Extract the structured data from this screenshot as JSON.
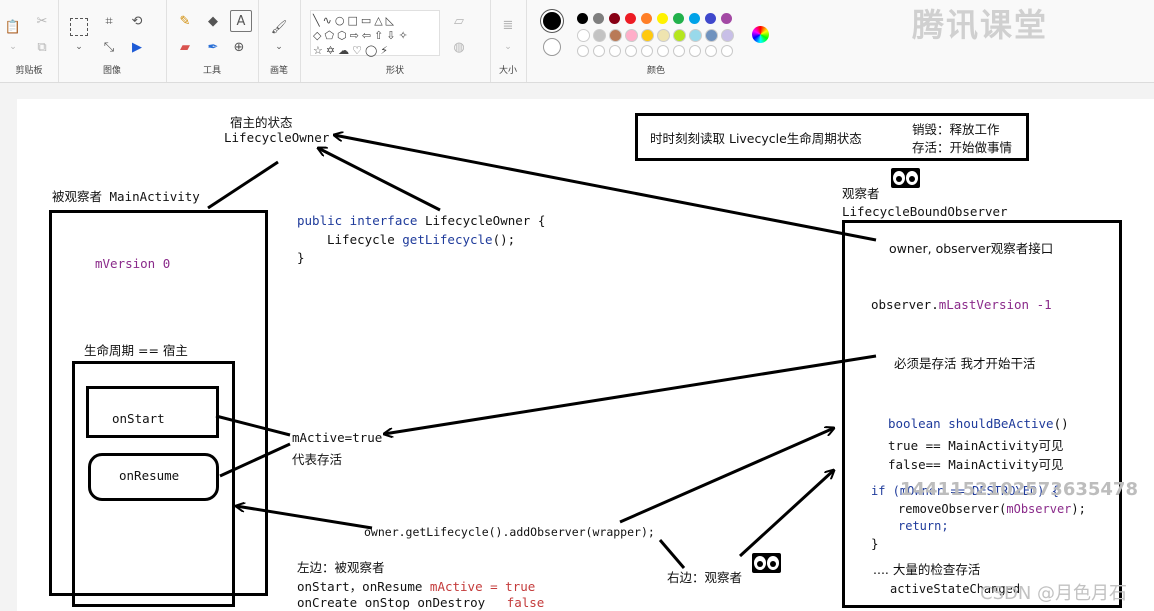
{
  "ribbon": {
    "groups": {
      "clipboard": "剪贴板",
      "image": "图像",
      "tools": "工具",
      "brushes": "画笔",
      "shapes": "形状",
      "size": "大小",
      "colors": "颜色"
    },
    "tools_text_glyph": "A",
    "palette_row1": [
      "#000000",
      "#7f7f7f",
      "#880015",
      "#ed1c24",
      "#ff7f27",
      "#fff200",
      "#22b14c",
      "#00a2e8",
      "#3f48cc",
      "#a349a4"
    ],
    "palette_row2": [
      "#ffffff",
      "#c3c3c3",
      "#b97a57",
      "#ffaec9",
      "#ffc90e",
      "#efe4b0",
      "#b5e61d",
      "#99d9ea",
      "#7092be",
      "#c8bfe7"
    ],
    "watermark": "腾讯课堂"
  },
  "canvas": {
    "host_state_title": "宿主的状态",
    "host_state_owner": "LifecycleOwner",
    "observed_label": "被观察者 MainActivity",
    "mversion": "mVersion 0",
    "lifecycle_host": "生命周期 == 宿主",
    "onstart": "onStart",
    "onresume": "onResume",
    "interface_line1_kw": "public interface",
    "interface_line1_name": "LifecycleOwner {",
    "interface_line2_type": "Lifecycle",
    "interface_line2_method": "getLifecycle",
    "interface_line2_end": "();",
    "interface_line3": "}",
    "mactive": "mActive=true",
    "mactive_desc": "代表存活",
    "add_observer": "owner.getLifecycle().addObserver(wrapper);",
    "left_title": "左边：被观察者",
    "left_line2_a": "onStart，onResume",
    "left_line2_b": "mActive = true",
    "left_line3_a": "onCreate onStop onDestroy",
    "left_line3_b": "false",
    "right_label": "右边：观察者",
    "top_box_text": "时时刻刻读取 Livecycle生命周期状态",
    "destroy_text": "销毁：释放工作",
    "alive_text": "存活：开始做事情",
    "observer_title": "观察者",
    "observer_class": "LifecycleBoundObserver",
    "owner_iface": "owner, observer观察者接口",
    "last_version_a": "observer.",
    "last_version_b": "mLastVersion",
    "last_version_c": "-1",
    "must_alive": "必须是存活 我才开始干活",
    "sba_kw": "boolean",
    "sba_name": "shouldBeActive",
    "sba_end": "()",
    "sba_true": "true == MainActivity可见",
    "sba_false": "false== MainActivity可见",
    "if_line": "if (mOwner == DESTROYED) {",
    "remove_a": "removeObserver(",
    "remove_b": "mObserver",
    "remove_c": ");",
    "return_line": "return;",
    "close_brace": "}",
    "many_checks": ".... 大量的检查存活",
    "active_changed": "activeStateChanged",
    "overlay_number": "1441152102573635478",
    "csdn_mark": "CSDN @月色月石"
  }
}
